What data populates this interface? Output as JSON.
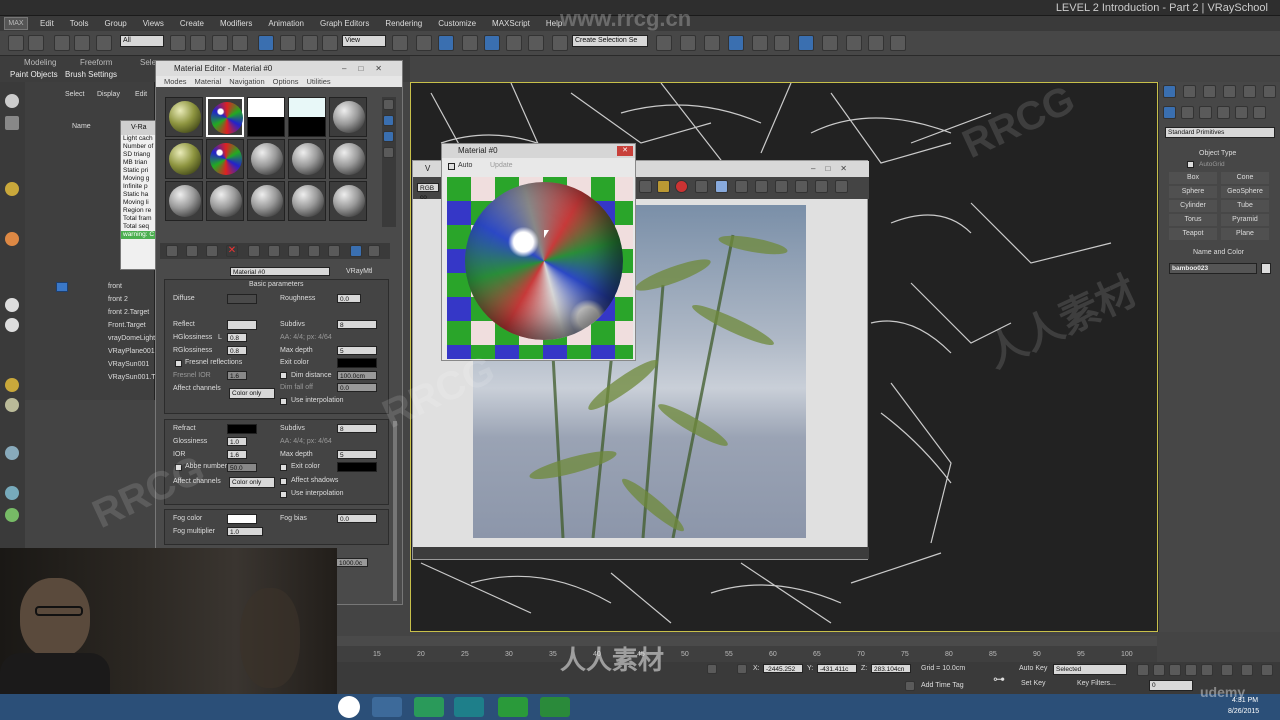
{
  "window": {
    "title": "LEVEL 2 Introduction - Part 2  |  VRaySchool",
    "logo": "MAX"
  },
  "menu": [
    "Edit",
    "Tools",
    "Group",
    "Views",
    "Create",
    "Modifiers",
    "Animation",
    "Graph Editors",
    "Rendering",
    "Customize",
    "MAXScript",
    "Help"
  ],
  "toolbar": {
    "filter": "All",
    "view": "View",
    "selection_set": "Create Selection Se"
  },
  "ribbon": {
    "tabs": [
      "Modeling",
      "Freeform",
      "Sele"
    ],
    "sub": [
      "Paint Objects",
      "Brush Settings"
    ]
  },
  "scene_explorer": {
    "tabs": [
      "Select",
      "Display",
      "Edit"
    ],
    "column": "Name",
    "items": [
      "front",
      "front 2",
      "front 2.Target",
      "Front.Target",
      "vrayDomeLight",
      "VRayPlane001",
      "VRaySun001",
      "VRaySun001.Ta"
    ]
  },
  "vray_log": {
    "title": "V-Ra",
    "lines": [
      "Light cach",
      "Number of",
      "SD triang",
      "MB trian",
      "Static pri",
      "Moving g",
      "Infinite p",
      "Static ha",
      "Moving li",
      "Region re",
      "Total fram",
      "Total seq",
      "warning: C"
    ]
  },
  "material_editor": {
    "title": "Material Editor - Material #0",
    "menu": [
      "Modes",
      "Material",
      "Navigation",
      "Options",
      "Utilities"
    ],
    "material_name": "Material #0",
    "material_type": "VRayMtl",
    "rollout_title": "Basic parameters",
    "diffuse": {
      "label": "Diffuse",
      "roughness_label": "Roughness",
      "roughness": "0.0"
    },
    "reflect": {
      "label": "Reflect",
      "hglossiness_label": "HGlossiness",
      "hglossiness": "0.8",
      "lock": "L",
      "rglossiness_label": "RGlossiness",
      "rglossiness": "0.8",
      "fresnel": "Fresnel reflections",
      "fresnel_ior_label": "Fresnel IOR",
      "fresnel_ior": "1.6",
      "subdivs_label": "Subdivs",
      "subdivs": "8",
      "aa": "AA: 4/4; px: 4/64",
      "max_depth_label": "Max depth",
      "max_depth": "5",
      "exit_color": "Exit color",
      "dim_distance": "Dim distance",
      "dim_distance_value": "100.0cm",
      "dim_falloff": "Dim fall off",
      "dim_falloff_value": "0.0",
      "affect_channels_label": "Affect channels",
      "affect_channels": "Color only",
      "use_interp": "Use interpolation"
    },
    "refract": {
      "label": "Refract",
      "glossiness_label": "Glossiness",
      "glossiness": "1.0",
      "ior_label": "IOR",
      "ior": "1.6",
      "abbe_label": "Abbe number",
      "abbe": "50.0",
      "subdivs_label": "Subdivs",
      "subdivs": "8",
      "aa": "AA: 4/4; px: 4/64",
      "max_depth_label": "Max depth",
      "max_depth": "5",
      "exit_color": "Exit color",
      "affect_shadows": "Affect shadows",
      "affect_channels_label": "Affect channels",
      "affect_channels": "Color only",
      "use_interp": "Use interpolation"
    },
    "fog": {
      "color_label": "Fog color",
      "multiplier_label": "Fog multiplier",
      "multiplier": "1.0",
      "bias_label": "Fog bias",
      "bias": "0.0",
      "extra": "1000.0c"
    }
  },
  "material_preview": {
    "title": "Material #0",
    "auto": "Auto",
    "update": "Update"
  },
  "frame_buffer": {
    "title": "V",
    "channel": "RGB co"
  },
  "command_panel": {
    "category": "Standard Primitives",
    "object_type_title": "Object Type",
    "autogrid": "AutoGrid",
    "buttons": [
      "Box",
      "Cone",
      "Sphere",
      "GeoSphere",
      "Cylinder",
      "Tube",
      "Torus",
      "Pyramid",
      "Teapot",
      "Plane"
    ],
    "name_color_title": "Name and Color",
    "object_name": "bamboo023"
  },
  "timeline": {
    "ticks": [
      "15",
      "20",
      "25",
      "30",
      "35",
      "40",
      "45",
      "50",
      "55",
      "60",
      "65",
      "70",
      "75",
      "80",
      "85",
      "90",
      "95",
      "100"
    ]
  },
  "status": {
    "x_label": "X:",
    "x": "-2445.252",
    "y_label": "Y:",
    "y": "-431.411c",
    "z_label": "Z:",
    "z": "283.104cn",
    "grid": "Grid = 10.0cm",
    "add_time_tag": "Add Time Tag",
    "auto_key": "Auto Key",
    "selected": "Selected",
    "set_key": "Set Key",
    "key_filters": "Key Filters...",
    "frame": "0"
  },
  "clock": {
    "time": "4:31 PM",
    "date": "8/26/2015"
  },
  "watermarks": [
    "RRCG",
    "人人素材",
    "www.rrcg.cn",
    "udemy"
  ],
  "colors": {
    "viewport_border": "#c8c04a",
    "accent_blue": "#3a78c8",
    "taskbar": "#2b4f78"
  }
}
